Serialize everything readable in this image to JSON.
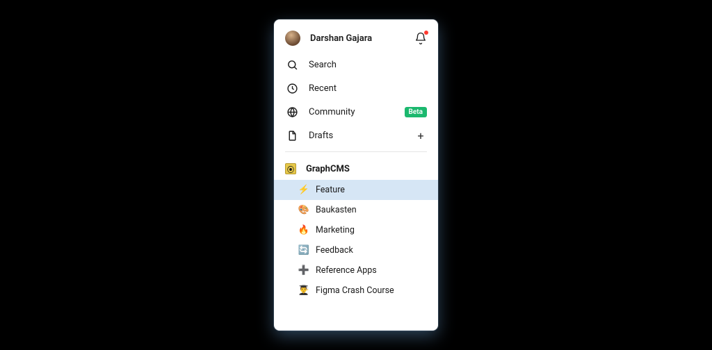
{
  "user": {
    "name": "Darshan Gajara"
  },
  "nav": {
    "search": "Search",
    "recent": "Recent",
    "community": "Community",
    "community_badge": "Beta",
    "drafts": "Drafts"
  },
  "workspace": {
    "name": "GraphCMS",
    "projects": [
      {
        "emoji": "⚡",
        "label": "Feature",
        "selected": true
      },
      {
        "emoji": "🎨",
        "label": "Baukasten",
        "selected": false
      },
      {
        "emoji": "🔥",
        "label": "Marketing",
        "selected": false
      },
      {
        "emoji": "🔄",
        "label": "Feedback",
        "selected": false
      },
      {
        "emoji": "➕",
        "label": "Reference Apps",
        "selected": false
      },
      {
        "emoji": "👨‍🎓",
        "label": "Figma Crash Course",
        "selected": false
      }
    ]
  }
}
